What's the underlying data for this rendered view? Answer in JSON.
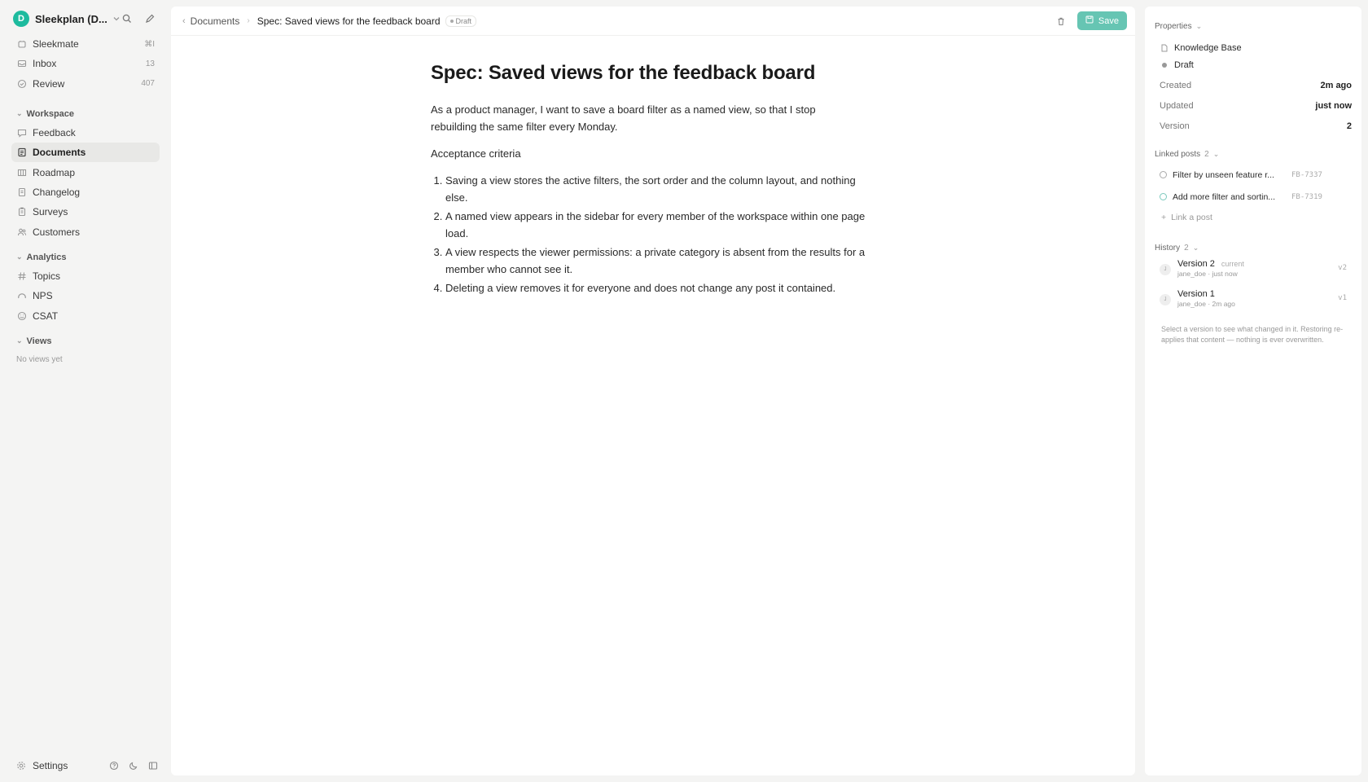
{
  "workspace": {
    "avatar_letter": "D",
    "name": "Sleekplan (D...",
    "accent": "#1dbb9e"
  },
  "sidebar": {
    "top_items": [
      {
        "label": "Sleekmate",
        "count": "⌘I"
      },
      {
        "label": "Inbox",
        "count": "13"
      },
      {
        "label": "Review",
        "count": "407"
      }
    ],
    "workspace_section": {
      "title": "Workspace",
      "items": [
        {
          "label": "Feedback"
        },
        {
          "label": "Documents"
        },
        {
          "label": "Roadmap"
        },
        {
          "label": "Changelog"
        },
        {
          "label": "Surveys"
        },
        {
          "label": "Customers"
        }
      ]
    },
    "analytics_section": {
      "title": "Analytics",
      "items": [
        {
          "label": "Topics"
        },
        {
          "label": "NPS"
        },
        {
          "label": "CSAT"
        }
      ]
    },
    "views_section": {
      "title": "Views",
      "empty": "No views yet"
    },
    "settings_label": "Settings"
  },
  "topbar": {
    "parent": "Documents",
    "current": "Spec: Saved views for the feedback board",
    "badge": "Draft",
    "save_label": "Save"
  },
  "document": {
    "title": "Spec: Saved views for the feedback board",
    "intro": "As a product manager, I want to save a board filter as a named view, so that I stop rebuilding the same filter every Monday.",
    "criteria_heading": "Acceptance criteria",
    "criteria": [
      "Saving a view stores the active filters, the sort order and the column layout, and nothing else.",
      "A named view appears in the sidebar for every member of the workspace within one page load.",
      "A view respects the viewer permissions: a private category is absent from the results for a member who cannot see it.",
      "Deleting a view removes it for everyone and does not change any post it contained."
    ]
  },
  "properties": {
    "title": "Properties",
    "collection": "Knowledge Base",
    "status": "Draft",
    "created_label": "Created",
    "created_value": "2m ago",
    "updated_label": "Updated",
    "updated_value": "just now",
    "version_label": "Version",
    "version_value": "2"
  },
  "linked_posts": {
    "title": "Linked posts",
    "count": "2",
    "items": [
      {
        "title": "Filter by unseen feature r...",
        "id": "FB-7337"
      },
      {
        "title": "Add more filter and sortin...",
        "id": "FB-7319"
      }
    ],
    "add_label": "Link a post"
  },
  "history": {
    "title": "History",
    "count": "2",
    "items": [
      {
        "avatar": "J",
        "name": "Version 2",
        "current": "current",
        "meta": "jane_doe · just now",
        "tag": "v2"
      },
      {
        "avatar": "J",
        "name": "Version 1",
        "current": "",
        "meta": "jane_doe · 2m ago",
        "tag": "v1"
      }
    ],
    "hint": "Select a version to see what changed in it. Restoring re-applies that content — nothing is ever overwritten."
  }
}
